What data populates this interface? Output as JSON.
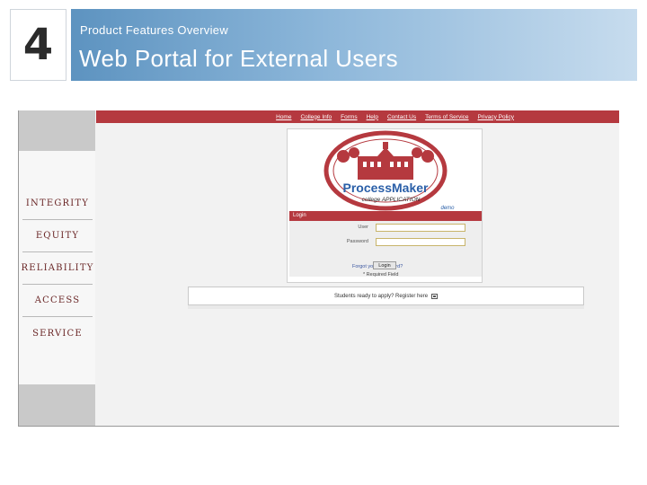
{
  "slide": {
    "number": "4",
    "subtitle": "Product Features Overview",
    "title": "Web Portal for External Users"
  },
  "portal": {
    "values": [
      "INTEGRITY",
      "EQUITY",
      "RELIABILITY",
      "ACCESS",
      "SERVICE"
    ],
    "nav": [
      "Home",
      "College Info",
      "Forms",
      "Help",
      "Contact Us",
      "Terms of Service",
      "Privacy Policy"
    ],
    "logo": {
      "brand_a": "Process",
      "brand_b": "Maker",
      "tagline": "college APPLICATION",
      "demo": "demo"
    },
    "login": {
      "header": "Login",
      "user_label": "User",
      "password_label": "Password",
      "forgot": "Forgot your password?",
      "button": "Login",
      "required": "* Required Field"
    },
    "register": "Students ready to apply? Register here"
  },
  "colors": {
    "nav_red": "#b5393f",
    "header_blue": "#5d93c0",
    "value_text": "#6a2626"
  }
}
